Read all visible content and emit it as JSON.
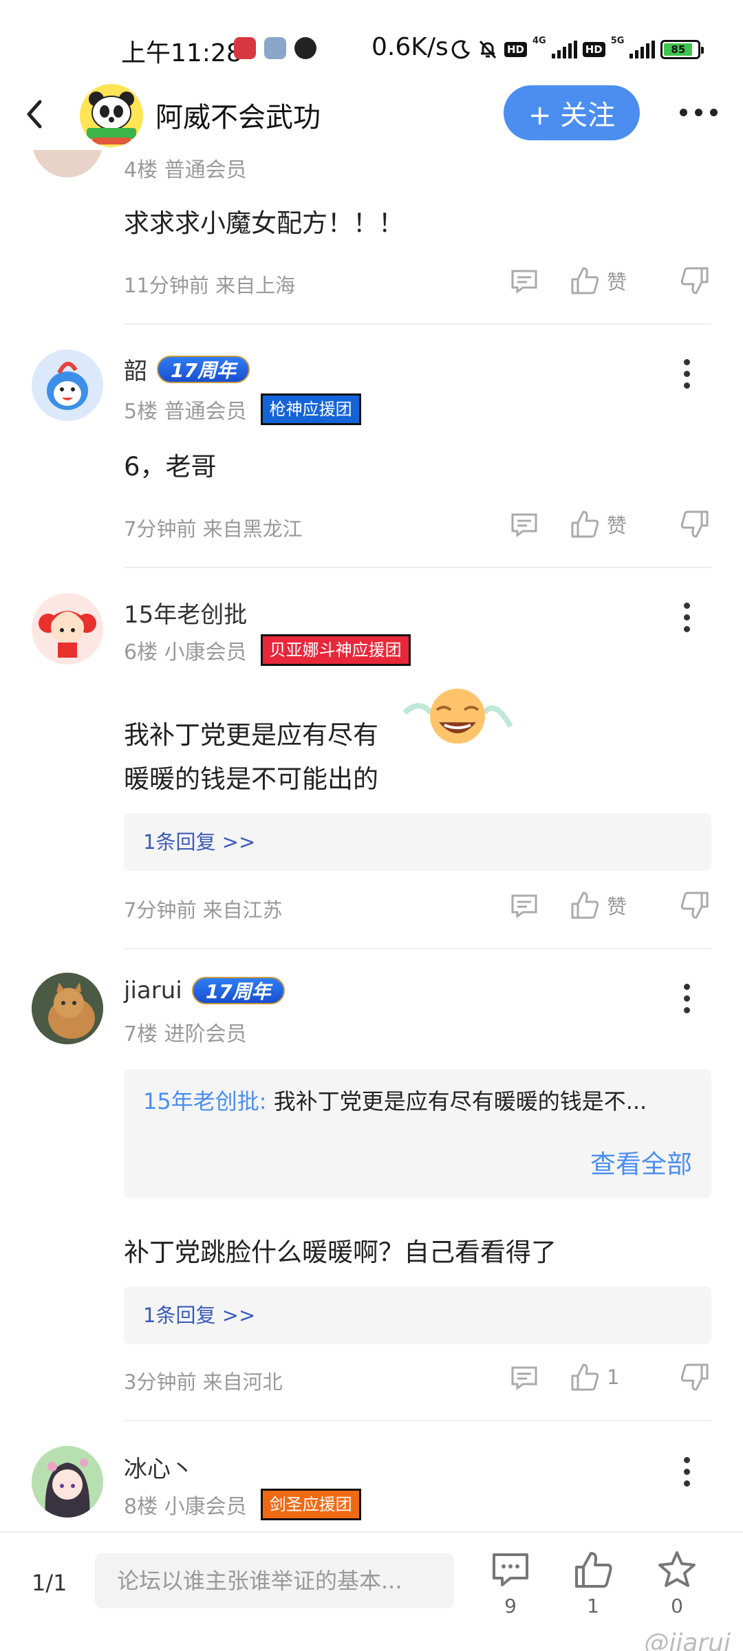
{
  "status_bar": {
    "time": "上午11:28",
    "speed": "0.6K/s",
    "net1": "4G",
    "net2": "5G",
    "battery": "85"
  },
  "header": {
    "forum_name": "阿威不会武功",
    "follow_label": "+ 关注"
  },
  "comments": [
    {
      "floor_meta": "4楼 普通会员",
      "text": "求求求小魔女配方！！！",
      "time": "11分钟前 来自上海",
      "like": "赞"
    },
    {
      "name": "韶",
      "anniv": "17周年",
      "floor_meta": "5楼 普通会员",
      "badge": "枪神应援团",
      "text": "6，老哥",
      "time": "7分钟前 来自黑龙江",
      "like": "赞"
    },
    {
      "name": "15年老创批",
      "floor_meta": "6楼 小康会员",
      "badge": "贝亚娜斗神应援团",
      "text_line1": "我补丁党更是应有尽有",
      "text_line2": "暖暖的钱是不可能出的",
      "reply": "1条回复 >>",
      "time": "7分钟前 来自江苏",
      "like": "赞"
    },
    {
      "name": "jiarui",
      "anniv": "17周年",
      "floor_meta": "7楼 进阶会员",
      "quote_user": "15年老创批:",
      "quote_text": " 我补丁党更是应有尽有暖暖的钱是不...",
      "quote_all": "查看全部",
      "text": "补丁党跳脸什么暖暖啊？自己看看得了",
      "reply": "1条回复 >>",
      "time": "3分钟前 来自河北",
      "like": "1"
    },
    {
      "name": "冰心丶",
      "floor_meta": "8楼 小康会员",
      "badge": "剑圣应援团"
    }
  ],
  "bottom_bar": {
    "page": "1/1",
    "input_placeholder": "论坛以谁主张谁举证的基本...",
    "comment_count": "9",
    "like_count": "1",
    "star_count": "0",
    "watermark": "@jiarui"
  },
  "colors": {
    "accent": "#4b8ef0",
    "reply_link": "#3a5bb7",
    "meta_gray": "#999999"
  }
}
